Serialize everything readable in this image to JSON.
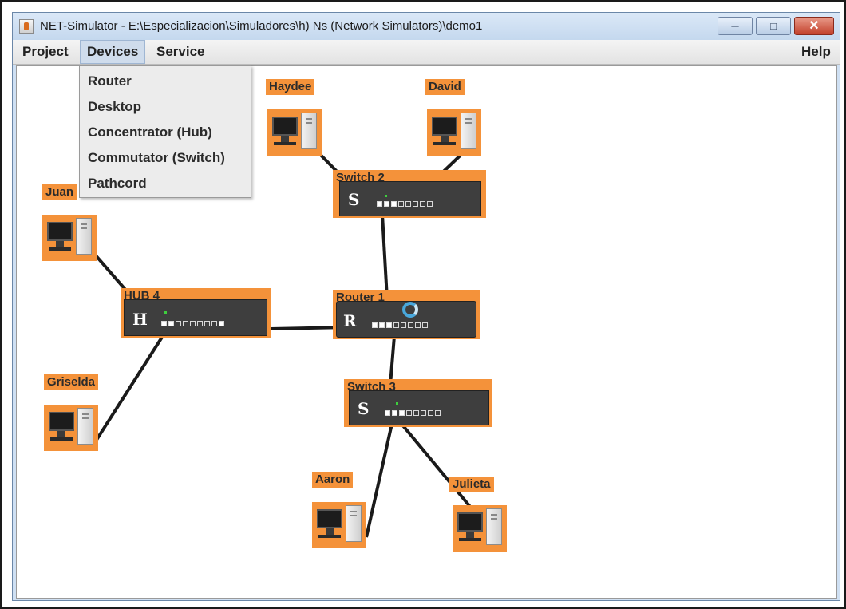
{
  "window": {
    "title": "NET-Simulator - E:\\Especializacion\\Simuladores\\h) Ns (Network Simulators)\\demo1",
    "buttons": {
      "minimize": "─",
      "maximize": "□",
      "close": "✕"
    }
  },
  "menubar": {
    "items": [
      "Project",
      "Devices",
      "Service"
    ],
    "help": "Help",
    "active": "Devices"
  },
  "devices_menu": {
    "items": [
      "Router",
      "Desktop",
      "Concentrator (Hub)",
      "Commutator (Switch)",
      "Pathcord"
    ]
  },
  "network": {
    "pcs": [
      "Haydee",
      "David",
      "Juan",
      "Griselda",
      "Aaron",
      "Julieta"
    ],
    "hub": {
      "label": "HUB 4",
      "letter": "H"
    },
    "router": {
      "label": "Router 1",
      "letter": "R"
    },
    "switch2": {
      "label": "Switch 2",
      "letter": "S"
    },
    "switch3": {
      "label": "Switch 3",
      "letter": "S"
    }
  },
  "colors": {
    "device_highlight": "#f4923a",
    "device_body": "#3e3e3e",
    "link": "#1a1a1a",
    "menu_active": "#cfdcec"
  }
}
